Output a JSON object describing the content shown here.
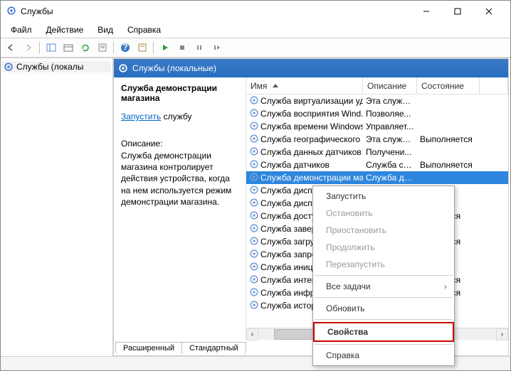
{
  "window": {
    "title": "Службы"
  },
  "menubar": {
    "items": [
      "Файл",
      "Действие",
      "Вид",
      "Справка"
    ]
  },
  "tree": {
    "root": "Службы (локалы"
  },
  "list_header": {
    "title": "Службы (локальные)"
  },
  "detail": {
    "service_name": "Служба демонстрации магазина",
    "start_link": "Запустить",
    "start_suffix": " службу",
    "desc_label": "Описание:",
    "desc_text": "Служба демонстрации магазина контролирует действия устройства, когда на нем используется режим демонстрации магазина."
  },
  "columns": {
    "name": "Имя",
    "desc": "Описание",
    "state": "Состояние"
  },
  "rows": [
    {
      "name": "Служба виртуализации уд...",
      "desc": "Эта служб...",
      "state": ""
    },
    {
      "name": "Служба восприятия Wind...",
      "desc": "Позволяе...",
      "state": ""
    },
    {
      "name": "Служба времени Windows",
      "desc": "Управляет...",
      "state": ""
    },
    {
      "name": "Служба географического ...",
      "desc": "Эта служб...",
      "state": "Выполняется"
    },
    {
      "name": "Служба данных датчиков",
      "desc": "Получени...",
      "state": ""
    },
    {
      "name": "Служба датчиков",
      "desc": "Служба се...",
      "state": "Выполняется"
    },
    {
      "name": "Служба демонстрации ма...",
      "desc": "Служба де...",
      "state": "",
      "selected": true
    },
    {
      "name": "Служба диспет",
      "desc": "",
      "state": ""
    },
    {
      "name": "Служба диспет",
      "desc": "",
      "state": ""
    },
    {
      "name": "Служба достуг",
      "desc": "",
      "state": "полняется"
    },
    {
      "name": "Служба заверш",
      "desc": "",
      "state": ""
    },
    {
      "name": "Служба загруз",
      "desc": "",
      "state": "полняется"
    },
    {
      "name": "Служба запрос",
      "desc": "",
      "state": ""
    },
    {
      "name": "Служба иници",
      "desc": "",
      "state": ""
    },
    {
      "name": "Служба интерс",
      "desc": "",
      "state": "полняется"
    },
    {
      "name": "Служба инфра",
      "desc": "",
      "state": "полняется"
    },
    {
      "name": "Служба истори",
      "desc": "",
      "state": ""
    }
  ],
  "tabs": {
    "ext": "Расширенный",
    "std": "Стандартный"
  },
  "ctx": {
    "start": "Запустить",
    "stop": "Остановить",
    "pause": "Приостановить",
    "resume": "Продолжить",
    "restart": "Перезапустить",
    "alltasks": "Все задачи",
    "refresh": "Обновить",
    "props": "Свойства",
    "help": "Справка"
  }
}
